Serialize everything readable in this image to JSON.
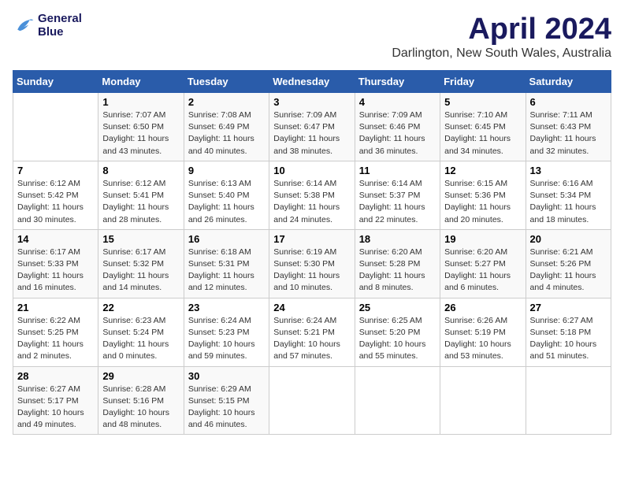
{
  "logo": {
    "line1": "General",
    "line2": "Blue"
  },
  "title": "April 2024",
  "subtitle": "Darlington, New South Wales, Australia",
  "days_header": [
    "Sunday",
    "Monday",
    "Tuesday",
    "Wednesday",
    "Thursday",
    "Friday",
    "Saturday"
  ],
  "weeks": [
    [
      {
        "day": "",
        "sunrise": "",
        "sunset": "",
        "daylight": ""
      },
      {
        "day": "1",
        "sunrise": "Sunrise: 7:07 AM",
        "sunset": "Sunset: 6:50 PM",
        "daylight": "Daylight: 11 hours and 43 minutes."
      },
      {
        "day": "2",
        "sunrise": "Sunrise: 7:08 AM",
        "sunset": "Sunset: 6:49 PM",
        "daylight": "Daylight: 11 hours and 40 minutes."
      },
      {
        "day": "3",
        "sunrise": "Sunrise: 7:09 AM",
        "sunset": "Sunset: 6:47 PM",
        "daylight": "Daylight: 11 hours and 38 minutes."
      },
      {
        "day": "4",
        "sunrise": "Sunrise: 7:09 AM",
        "sunset": "Sunset: 6:46 PM",
        "daylight": "Daylight: 11 hours and 36 minutes."
      },
      {
        "day": "5",
        "sunrise": "Sunrise: 7:10 AM",
        "sunset": "Sunset: 6:45 PM",
        "daylight": "Daylight: 11 hours and 34 minutes."
      },
      {
        "day": "6",
        "sunrise": "Sunrise: 7:11 AM",
        "sunset": "Sunset: 6:43 PM",
        "daylight": "Daylight: 11 hours and 32 minutes."
      }
    ],
    [
      {
        "day": "7",
        "sunrise": "Sunrise: 6:12 AM",
        "sunset": "Sunset: 5:42 PM",
        "daylight": "Daylight: 11 hours and 30 minutes."
      },
      {
        "day": "8",
        "sunrise": "Sunrise: 6:12 AM",
        "sunset": "Sunset: 5:41 PM",
        "daylight": "Daylight: 11 hours and 28 minutes."
      },
      {
        "day": "9",
        "sunrise": "Sunrise: 6:13 AM",
        "sunset": "Sunset: 5:40 PM",
        "daylight": "Daylight: 11 hours and 26 minutes."
      },
      {
        "day": "10",
        "sunrise": "Sunrise: 6:14 AM",
        "sunset": "Sunset: 5:38 PM",
        "daylight": "Daylight: 11 hours and 24 minutes."
      },
      {
        "day": "11",
        "sunrise": "Sunrise: 6:14 AM",
        "sunset": "Sunset: 5:37 PM",
        "daylight": "Daylight: 11 hours and 22 minutes."
      },
      {
        "day": "12",
        "sunrise": "Sunrise: 6:15 AM",
        "sunset": "Sunset: 5:36 PM",
        "daylight": "Daylight: 11 hours and 20 minutes."
      },
      {
        "day": "13",
        "sunrise": "Sunrise: 6:16 AM",
        "sunset": "Sunset: 5:34 PM",
        "daylight": "Daylight: 11 hours and 18 minutes."
      }
    ],
    [
      {
        "day": "14",
        "sunrise": "Sunrise: 6:17 AM",
        "sunset": "Sunset: 5:33 PM",
        "daylight": "Daylight: 11 hours and 16 minutes."
      },
      {
        "day": "15",
        "sunrise": "Sunrise: 6:17 AM",
        "sunset": "Sunset: 5:32 PM",
        "daylight": "Daylight: 11 hours and 14 minutes."
      },
      {
        "day": "16",
        "sunrise": "Sunrise: 6:18 AM",
        "sunset": "Sunset: 5:31 PM",
        "daylight": "Daylight: 11 hours and 12 minutes."
      },
      {
        "day": "17",
        "sunrise": "Sunrise: 6:19 AM",
        "sunset": "Sunset: 5:30 PM",
        "daylight": "Daylight: 11 hours and 10 minutes."
      },
      {
        "day": "18",
        "sunrise": "Sunrise: 6:20 AM",
        "sunset": "Sunset: 5:28 PM",
        "daylight": "Daylight: 11 hours and 8 minutes."
      },
      {
        "day": "19",
        "sunrise": "Sunrise: 6:20 AM",
        "sunset": "Sunset: 5:27 PM",
        "daylight": "Daylight: 11 hours and 6 minutes."
      },
      {
        "day": "20",
        "sunrise": "Sunrise: 6:21 AM",
        "sunset": "Sunset: 5:26 PM",
        "daylight": "Daylight: 11 hours and 4 minutes."
      }
    ],
    [
      {
        "day": "21",
        "sunrise": "Sunrise: 6:22 AM",
        "sunset": "Sunset: 5:25 PM",
        "daylight": "Daylight: 11 hours and 2 minutes."
      },
      {
        "day": "22",
        "sunrise": "Sunrise: 6:23 AM",
        "sunset": "Sunset: 5:24 PM",
        "daylight": "Daylight: 11 hours and 0 minutes."
      },
      {
        "day": "23",
        "sunrise": "Sunrise: 6:24 AM",
        "sunset": "Sunset: 5:23 PM",
        "daylight": "Daylight: 10 hours and 59 minutes."
      },
      {
        "day": "24",
        "sunrise": "Sunrise: 6:24 AM",
        "sunset": "Sunset: 5:21 PM",
        "daylight": "Daylight: 10 hours and 57 minutes."
      },
      {
        "day": "25",
        "sunrise": "Sunrise: 6:25 AM",
        "sunset": "Sunset: 5:20 PM",
        "daylight": "Daylight: 10 hours and 55 minutes."
      },
      {
        "day": "26",
        "sunrise": "Sunrise: 6:26 AM",
        "sunset": "Sunset: 5:19 PM",
        "daylight": "Daylight: 10 hours and 53 minutes."
      },
      {
        "day": "27",
        "sunrise": "Sunrise: 6:27 AM",
        "sunset": "Sunset: 5:18 PM",
        "daylight": "Daylight: 10 hours and 51 minutes."
      }
    ],
    [
      {
        "day": "28",
        "sunrise": "Sunrise: 6:27 AM",
        "sunset": "Sunset: 5:17 PM",
        "daylight": "Daylight: 10 hours and 49 minutes."
      },
      {
        "day": "29",
        "sunrise": "Sunrise: 6:28 AM",
        "sunset": "Sunset: 5:16 PM",
        "daylight": "Daylight: 10 hours and 48 minutes."
      },
      {
        "day": "30",
        "sunrise": "Sunrise: 6:29 AM",
        "sunset": "Sunset: 5:15 PM",
        "daylight": "Daylight: 10 hours and 46 minutes."
      },
      {
        "day": "",
        "sunrise": "",
        "sunset": "",
        "daylight": ""
      },
      {
        "day": "",
        "sunrise": "",
        "sunset": "",
        "daylight": ""
      },
      {
        "day": "",
        "sunrise": "",
        "sunset": "",
        "daylight": ""
      },
      {
        "day": "",
        "sunrise": "",
        "sunset": "",
        "daylight": ""
      }
    ]
  ]
}
